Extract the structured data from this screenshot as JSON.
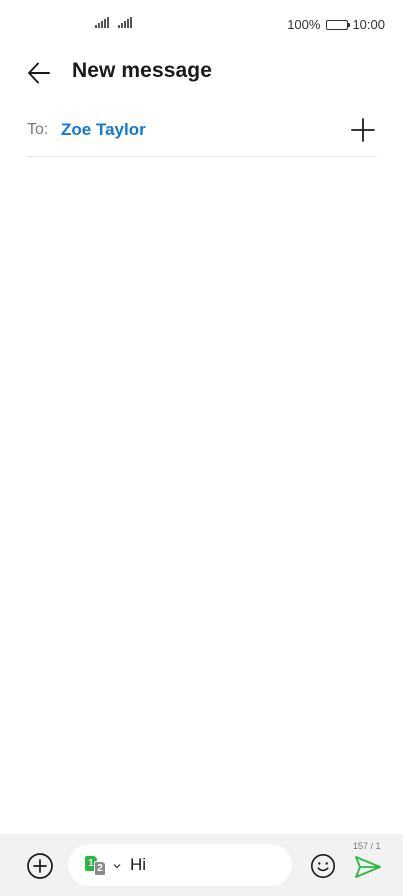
{
  "status_bar": {
    "battery_text": "100%",
    "time": "10:00",
    "battery_level": 1.0,
    "signal_icons": [
      "signal-bars-icon",
      "signal-bars-icon"
    ]
  },
  "header": {
    "back_icon": "arrow-left-icon",
    "title": "New message"
  },
  "recipients": {
    "label": "To:",
    "items": [
      {
        "name": "Zoe Taylor"
      }
    ],
    "add_icon": "plus-icon"
  },
  "composer": {
    "attach_icon": "plus-circle-icon",
    "sim": {
      "primary": "1",
      "secondary": "2",
      "caret_icon": "caret-down-icon"
    },
    "message_value": "Hi",
    "emoji_icon": "smiley-icon",
    "char_counter": "157 / 1",
    "send_icon": "send-icon"
  },
  "colors": {
    "accent_blue": "#1677d2",
    "send_green": "#2bb741",
    "sim_gray": "#8c8c8c",
    "composer_bg": "#f2f2f2"
  }
}
